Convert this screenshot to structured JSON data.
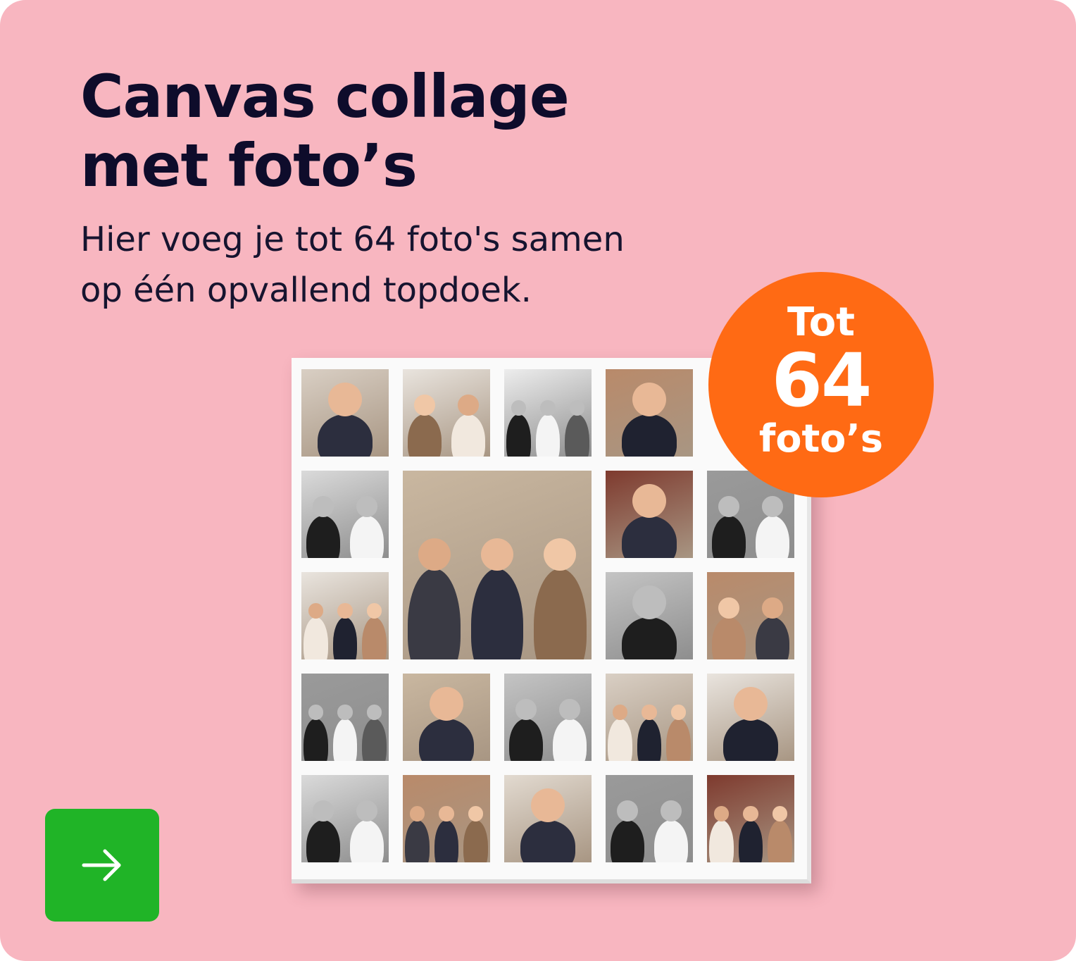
{
  "heading": {
    "line1": "Canvas collage",
    "line2": "met foto’s"
  },
  "description": {
    "line1": "Hier voeg je tot 64 foto's samen",
    "line2": "op één opvallend topdoek."
  },
  "badge": {
    "top": "Tot",
    "number": "64",
    "bottom": "foto’s",
    "color": "#FF6A14"
  },
  "cta": {
    "icon": "arrow-right-icon",
    "color": "#20B427"
  },
  "colors": {
    "background": "#F8B6C0",
    "heading": "#0E0C2B"
  },
  "collage": {
    "photos": [
      {
        "id": "family-sofa-color",
        "bw": false
      },
      {
        "id": "newborn-sleeping-blanket",
        "bw": false
      },
      {
        "id": "boy-laughing-flowers-bw",
        "bw": true
      },
      {
        "id": "mother-and-boy-color",
        "bw": false
      },
      {
        "id": "family-group-bw",
        "bw": true
      },
      {
        "id": "three-brothers-with-baby",
        "bw": false
      },
      {
        "id": "boy-portrait-smiling",
        "bw": false
      },
      {
        "id": "mother-hugging-son-bw",
        "bw": true
      },
      {
        "id": "toddler-laughing",
        "bw": false
      },
      {
        "id": "boy-and-baby-bw",
        "bw": true
      },
      {
        "id": "boy-by-red-wall",
        "bw": false
      },
      {
        "id": "newborn-close-up-bw",
        "bw": true
      },
      {
        "id": "father-and-son",
        "bw": false
      },
      {
        "id": "baby-held-bw",
        "bw": true
      },
      {
        "id": "family-of-five-sofa",
        "bw": false
      },
      {
        "id": "siblings-with-newborn",
        "bw": false
      },
      {
        "id": "boy-holding-baby-bw",
        "bw": true
      },
      {
        "id": "family-on-floor",
        "bw": false
      },
      {
        "id": "parents-with-baby",
        "bw": false
      },
      {
        "id": "boy-close-up-bw",
        "bw": true
      },
      {
        "id": "family-on-sofa-with-baby",
        "bw": false
      }
    ]
  }
}
